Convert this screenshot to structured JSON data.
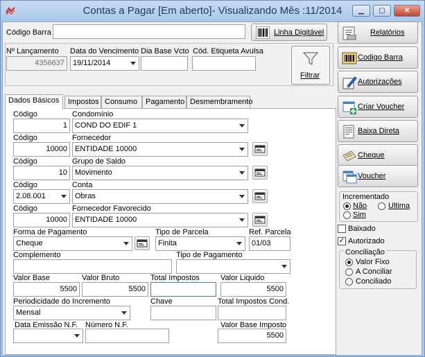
{
  "window": {
    "title": "Contas a Pagar [Em aberto]- Visualizando Mês :11/2014"
  },
  "top": {
    "barcode_label": "Código Barra",
    "barcode_value": "",
    "linha_digitavel_label": "Linha Digitável",
    "lancamento_label": "Nº Lançamento",
    "lancamento_value": "4356637",
    "vencimento_label": "Data do Vencimento",
    "vencimento_value": "19/11/2014",
    "dia_base_label": "Dia Base Vcto",
    "dia_base_value": "",
    "etiqueta_label": "Cód. Etiqueta Avulsa",
    "etiqueta_value": "",
    "filtrar_label": "Filtrar"
  },
  "tabs": [
    "Dados Básicos",
    "Impostos",
    "Consumo",
    "Pagamento",
    "Desmembramento"
  ],
  "form": {
    "codigo_label": "Código",
    "condominio_label": "Condomínio",
    "condominio_code": "1",
    "condominio_value": "COND DO EDIF 1",
    "fornecedor_label": "Fornecedor",
    "fornecedor_code": "10000",
    "fornecedor_value": "ENTIDADE 10000",
    "grupo_label": "Grupo de Saldo",
    "grupo_code": "10",
    "grupo_value": "Movimento",
    "conta_label": "Conta",
    "conta_code": "2.08.001",
    "conta_value": "Obras",
    "favorecido_label": "Fornecedor Favorecido",
    "favorecido_code": "10000",
    "favorecido_value": "ENTIDADE 10000",
    "forma_pag_label": "Forma de Pagamento",
    "forma_pag_value": "Cheque",
    "tipo_parcela_label": "Tipo de Parcela",
    "tipo_parcela_value": "Finita",
    "ref_parcela_label": "Ref. Parcela",
    "ref_parcela_value": "01/03",
    "complemento_label": "Complemento",
    "complemento_value": "",
    "tipo_pagamento_label": "Tipo de Pagamento",
    "tipo_pagamento_value": "",
    "valor_base_label": "Valor Base",
    "valor_base_value": "5500",
    "valor_bruto_label": "Valor Bruto",
    "valor_bruto_value": "5500",
    "total_impostos_label": "Total Impostos",
    "total_impostos_value": "",
    "valor_liquido_label": "Valor Liquido",
    "valor_liquido_value": "5500",
    "periodicidade_label": "Periodicidade do Incremento",
    "periodicidade_value": "Mensal",
    "chave_label": "Chave",
    "chave_value": "",
    "total_imp_cond_label": "Total Impostos Cond.",
    "total_imp_cond_value": "",
    "data_emissao_label": "Data Emissão N.F.",
    "data_emissao_value": "",
    "numero_nf_label": "Número N.F.",
    "numero_nf_value": "",
    "valor_base_imposto_label": "Valor Base Imposto",
    "valor_base_imposto_value": "5500"
  },
  "side": {
    "buttons": [
      "Relatórios",
      "Codigo Barra",
      "Autorizações",
      "Criar Voucher",
      "Baixa Direta",
      "Cheque",
      "Voucher"
    ],
    "incrementado_label": "Incrementado",
    "inc_options": [
      "Não",
      "Ultima",
      "Sim"
    ],
    "baixado_label": "Baixado",
    "autorizado_label": "Autorizado",
    "conciliacao_label": "Conciliação",
    "conc_options": [
      "Valor Fixo",
      "A Conciliar",
      "Conciliado"
    ]
  }
}
